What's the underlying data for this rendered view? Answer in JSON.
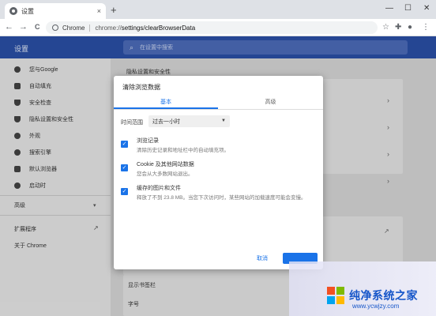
{
  "browser": {
    "tab_title": "设置",
    "tab_close": "×",
    "new_tab": "+",
    "window_controls": [
      "—",
      "☐",
      "✕"
    ],
    "nav": {
      "back": "←",
      "forward": "→",
      "reload": "C"
    },
    "omnibox": {
      "chrome_label": "Chrome",
      "url_prefix": "chrome://",
      "url_rest": "settings/clearBrowserData"
    },
    "toolbar_icons": [
      "star-icon",
      "extensions-icon",
      "profile-icon",
      "menu-icon"
    ]
  },
  "settings": {
    "title": "设置",
    "search_placeholder": "在设置中搜索",
    "sidebar": {
      "items": [
        {
          "label": "您与Google",
          "icon": "person-icon"
        },
        {
          "label": "自动填充",
          "icon": "autofill-icon"
        },
        {
          "label": "安全检查",
          "icon": "shield-icon"
        },
        {
          "label": "隐私设置和安全性",
          "icon": "privacy-shield-icon"
        },
        {
          "label": "外观",
          "icon": "palette-icon"
        },
        {
          "label": "搜索引擎",
          "icon": "search-icon"
        },
        {
          "label": "默认浏览器",
          "icon": "browser-icon"
        },
        {
          "label": "启动时",
          "icon": "power-icon"
        }
      ],
      "advanced": "高级",
      "extensions": "扩展程序",
      "about": "关于 Chrome"
    },
    "main": {
      "section_heading": "隐私设置和安全性",
      "bottom_items": [
        "显示书签栏",
        "字号"
      ]
    }
  },
  "dialog": {
    "title": "清除浏览数据",
    "tabs": [
      "基本",
      "高级"
    ],
    "time_range_label": "时间范围",
    "time_range_value": "过去一小时",
    "options": [
      {
        "title": "浏览记录",
        "desc": "清除历史记录和地址栏中的自动填充项。",
        "checked": true
      },
      {
        "title": "Cookie 及其他网站数据",
        "desc": "您会从大多数网站退出。",
        "checked": true
      },
      {
        "title": "缓存的图片和文件",
        "desc": "释放了不到 23.8 MB。当您下次访问时，某些网站的加载速度可能会变慢。",
        "checked": true
      }
    ],
    "cancel": "取消"
  },
  "watermark": {
    "brand": "纯净系统之家",
    "site": "www.ycwjzy.com"
  },
  "colors": {
    "header_blue": "#2b50a8",
    "accent_blue": "#1a73e8",
    "watermark_blue": "#1656c9"
  }
}
